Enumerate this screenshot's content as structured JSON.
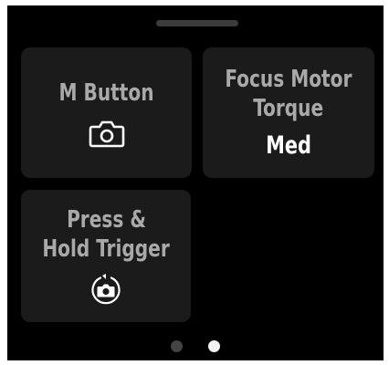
{
  "tiles": [
    {
      "title": "M Button",
      "icon": "camera-icon"
    },
    {
      "title_line1": "Focus Motor",
      "title_line2": "Torque",
      "value": "Med"
    },
    {
      "title_line1": "Press &",
      "title_line2": "Hold Trigger",
      "icon": "camera-burst-icon"
    }
  ],
  "pagination": {
    "pages": 2,
    "current_page": 2
  },
  "colors": {
    "background": "#000000",
    "tile": "#1b1b1b",
    "title_text": "#a9a9a9",
    "value_text": "#ffffff",
    "dot_active": "#f2f2f2",
    "dot_inactive": "#444444"
  }
}
